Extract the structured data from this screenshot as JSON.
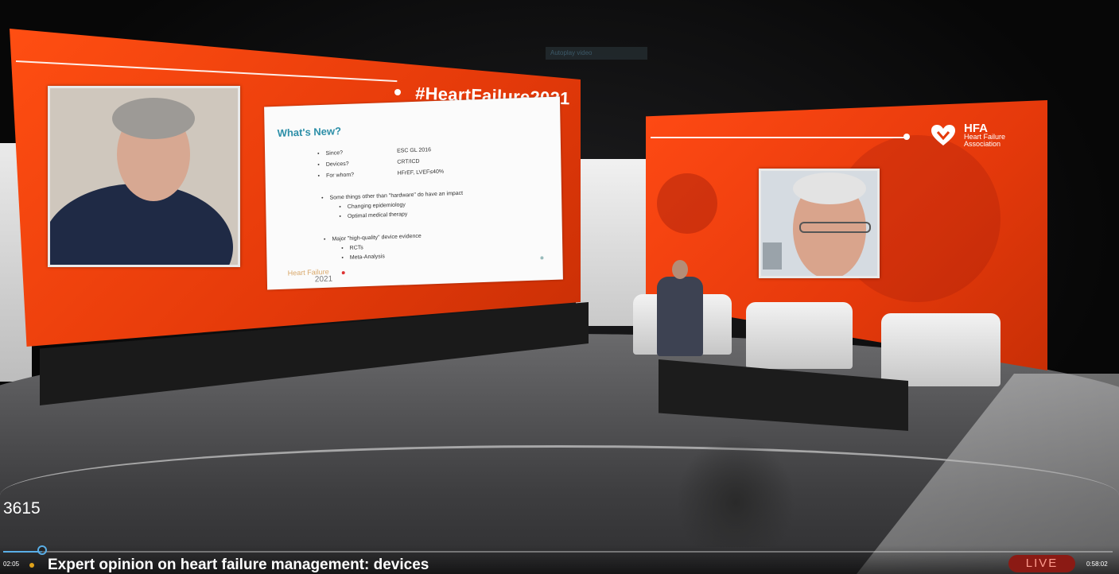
{
  "stage": {
    "hashtag": "#HeartFailure2021",
    "hfa": {
      "name": "HFA",
      "subtitle": "Heart Failure Association"
    },
    "caption_code": "3615",
    "overlay_label": "Autoplay video"
  },
  "slide": {
    "title": "What's New?",
    "rows": [
      {
        "label": "Since?",
        "value": "ESC GL 2016"
      },
      {
        "label": "Devices?",
        "value": "CRT/ICD"
      },
      {
        "label": "For whom?",
        "value": "HFrEF, LVEF≤40%"
      }
    ],
    "point2": "Some things other than \"hardware\" do have an impact",
    "point2_sub": [
      "Changing epidemiology",
      "Optimal medical therapy"
    ],
    "point3": "Major \"high-quality\" device evidence",
    "point3_sub": [
      "RCTs",
      "Meta-Analysis"
    ],
    "logo_line1": "Heart Failure",
    "logo_line2": "2021"
  },
  "player": {
    "time_current": "02:05",
    "title": "Expert opinion on heart failure management: devices",
    "live_label": "LIVE",
    "time_total": "0:58:02",
    "progress_fraction": 0.035
  },
  "colors": {
    "brand_red": "#e53a0a",
    "slide_title": "#2d8fa8",
    "progress": "#5aaee6",
    "live_bg": "#8b1a14"
  }
}
